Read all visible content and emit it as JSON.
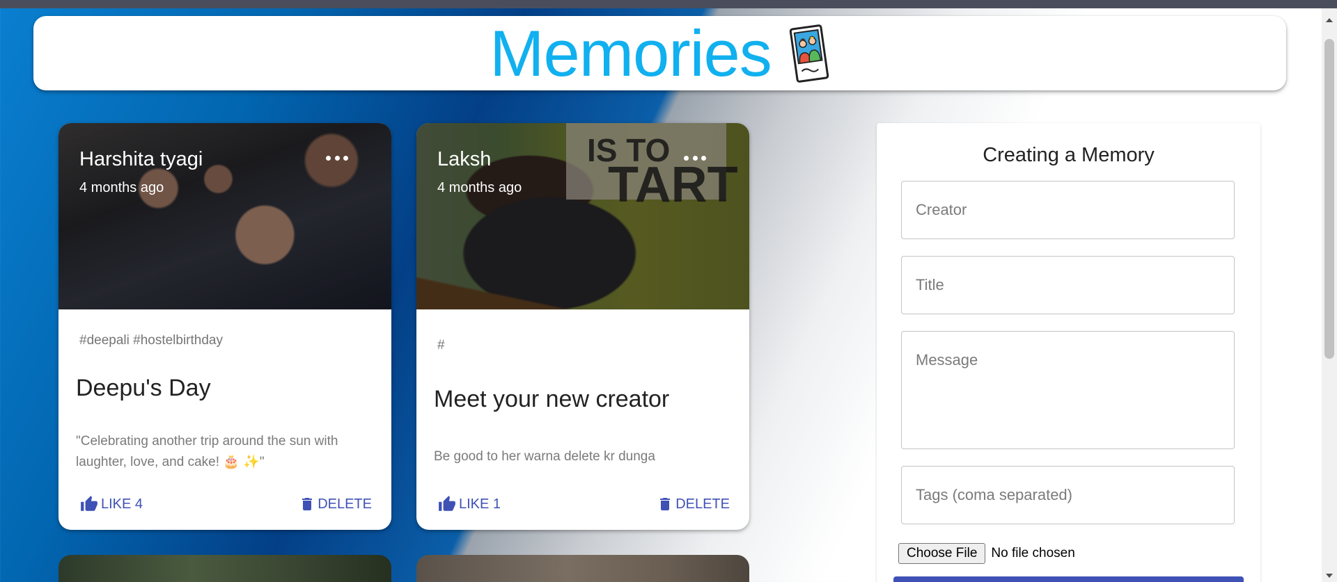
{
  "app": {
    "title": "Memories",
    "logo_icon": "photo-memory-icon"
  },
  "posts": [
    {
      "creator": "Harshita tyagi",
      "time": "4 months ago",
      "tags": "#deepali #hostelbirthday",
      "title": "Deepu's Day",
      "message": "\"Celebrating another trip around the sun with laughter, love, and cake! 🎂 ✨\"",
      "like_label": "LIKE 4",
      "delete_label": "DELETE"
    },
    {
      "creator": "Laksh",
      "time": "4 months ago",
      "tags": "#",
      "title": "Meet your new creator",
      "message": "Be good to her warna delete kr dunga",
      "like_label": "LIKE 1",
      "delete_label": "DELETE"
    }
  ],
  "form": {
    "heading": "Creating a Memory",
    "creator_placeholder": "Creator",
    "title_placeholder": "Title",
    "message_placeholder": "Message",
    "tags_placeholder": "Tags (coma separated)",
    "file_button": "Choose File",
    "file_status": "No file chosen"
  },
  "colors": {
    "brand": "#11b0ef",
    "action": "#3f51b5"
  }
}
